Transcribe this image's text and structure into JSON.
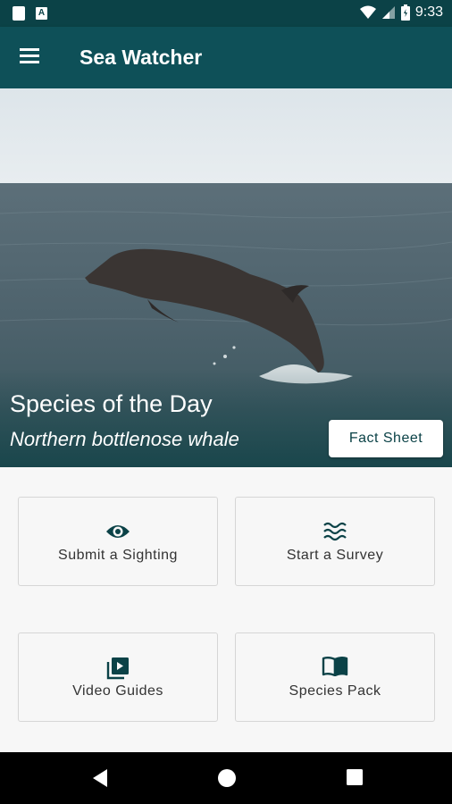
{
  "status": {
    "time": "9:33"
  },
  "app": {
    "title": "Sea Watcher"
  },
  "hero": {
    "heading": "Species of the Day",
    "species": "Northern bottlenose whale",
    "button_label": "Fact Sheet"
  },
  "tiles": [
    {
      "label": "Submit a Sighting",
      "icon": "eye-icon"
    },
    {
      "label": "Start a Survey",
      "icon": "waves-icon"
    },
    {
      "label": "Video Guides",
      "icon": "video-library-icon"
    },
    {
      "label": "Species Pack",
      "icon": "book-icon"
    }
  ],
  "colors": {
    "app_bar": "#0e5058",
    "status_bar": "#0b4247",
    "accent": "#0b4247"
  }
}
